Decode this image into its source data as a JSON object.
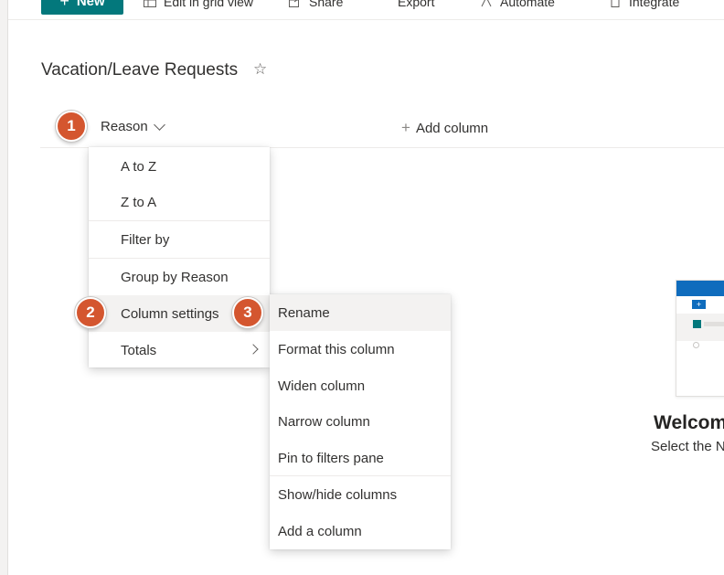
{
  "command_bar": {
    "new_label": "New",
    "items": [
      {
        "label": "Edit in grid view",
        "icon": "grid-icon"
      },
      {
        "label": "Share",
        "icon": "share-icon"
      },
      {
        "label": "Export",
        "icon": "export-icon"
      },
      {
        "label": "Automate",
        "icon": "automate-icon"
      },
      {
        "label": "Integrate",
        "icon": "integrate-icon"
      }
    ]
  },
  "page": {
    "title": "Vacation/Leave Requests",
    "favorite_icon": "star-icon"
  },
  "columns": {
    "reason": "Reason",
    "add_column": "Add column"
  },
  "badges": [
    "1",
    "2",
    "3"
  ],
  "column_menu": {
    "items": [
      "A to Z",
      "Z to A",
      "Filter by",
      "Group by Reason",
      "Column settings",
      "Totals"
    ]
  },
  "settings_submenu": {
    "items": [
      "Rename",
      "Format this column",
      "Widen column",
      "Narrow column",
      "Pin to filters pane",
      "Show/hide columns",
      "Add a column"
    ]
  },
  "welcome": {
    "title": "Welcome",
    "subtitle": "Select the N"
  },
  "colors": {
    "accent": "#03787c",
    "badge": "#d4562f",
    "brand_blue": "#0f6cbd"
  }
}
